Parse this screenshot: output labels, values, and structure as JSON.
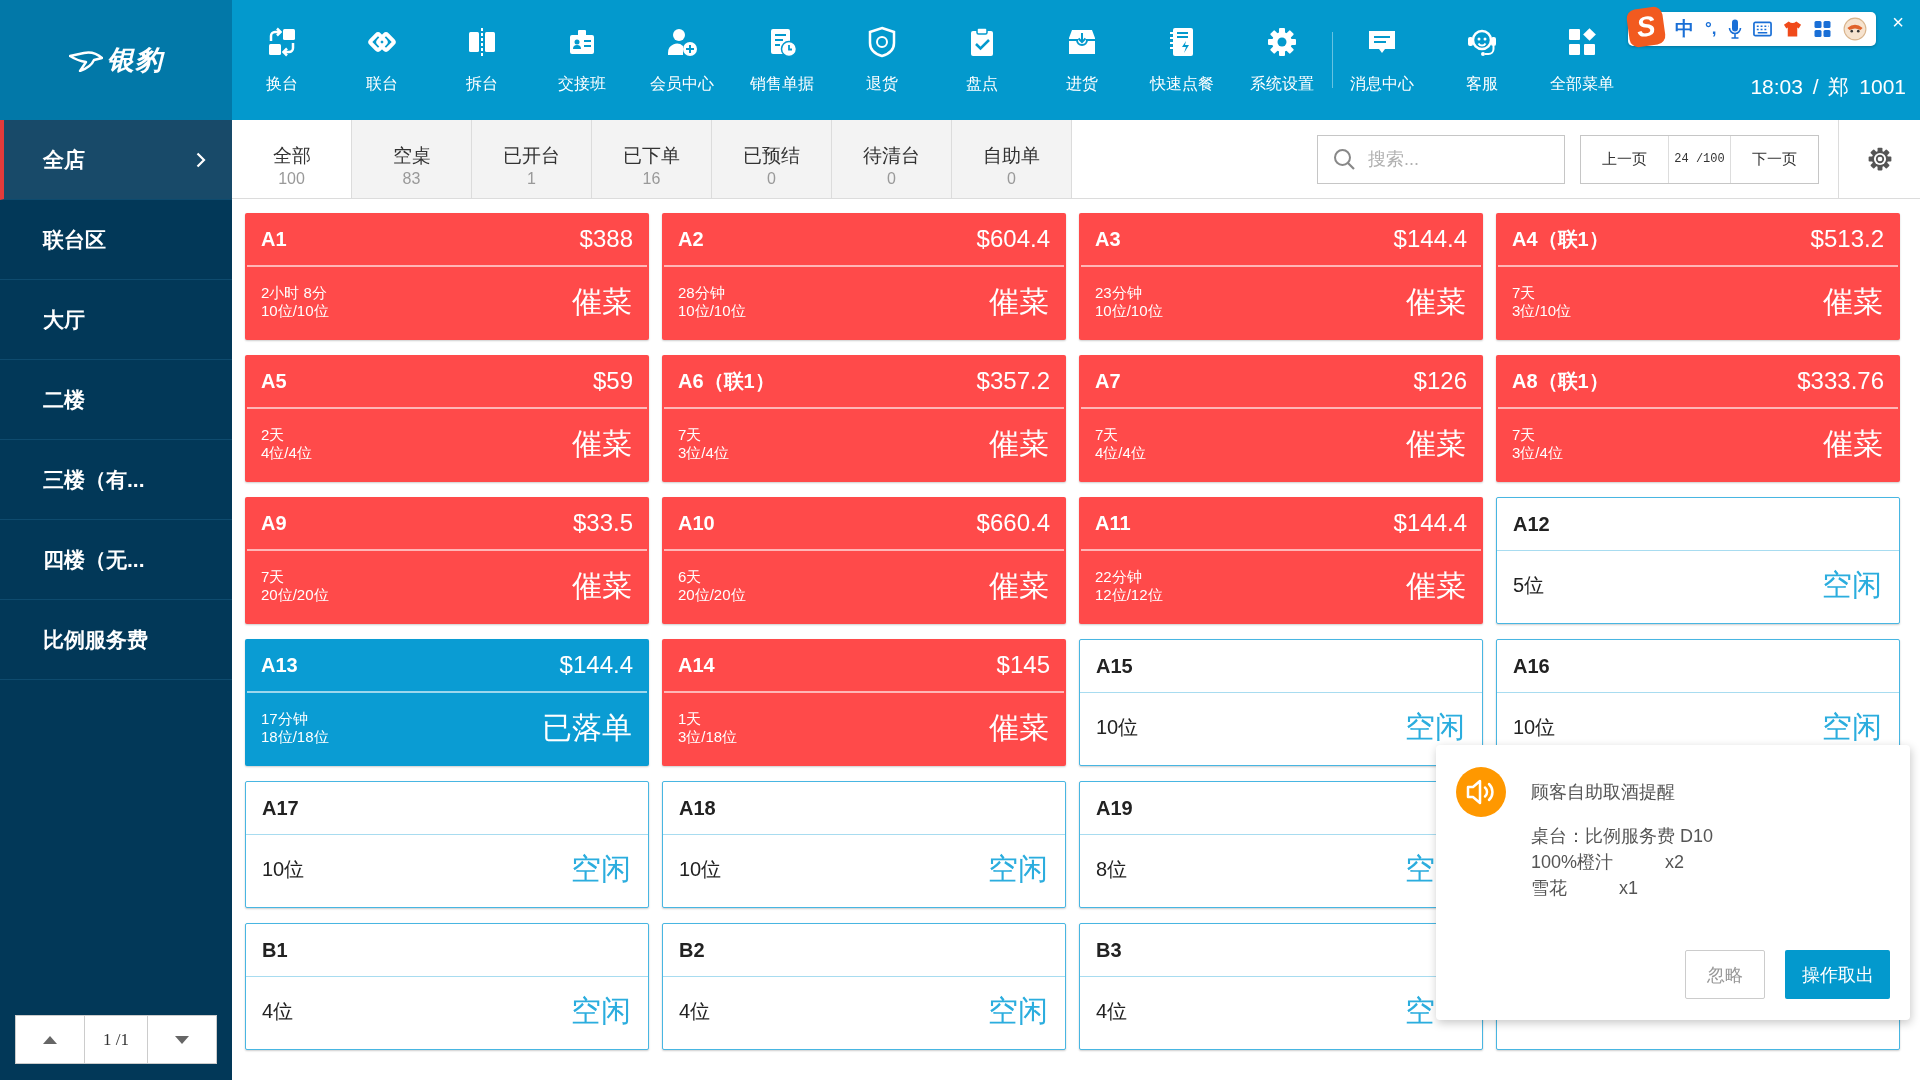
{
  "app": {
    "logo": "银豹"
  },
  "toolbar": {
    "main": [
      "换台",
      "联台",
      "拆台",
      "交接班",
      "会员中心",
      "销售单据",
      "退货",
      "盘点",
      "进货",
      "快速点餐",
      "系统设置"
    ],
    "extra": [
      "消息中心",
      "客服",
      "全部菜单"
    ]
  },
  "status_text": "18:03 / 郑 1001",
  "ime_bar": {
    "logo": "S",
    "mode": "中",
    "punct": "°,"
  },
  "window": {
    "close": "×"
  },
  "areas": [
    {
      "label": "全店",
      "selected": true
    },
    {
      "label": "联台区",
      "selected": false
    },
    {
      "label": "大厅",
      "selected": false
    },
    {
      "label": "二楼",
      "selected": false
    },
    {
      "label": "三楼（有...",
      "selected": false
    },
    {
      "label": "四楼（无...",
      "selected": false
    },
    {
      "label": "比例服务费",
      "selected": false
    }
  ],
  "area_pager": {
    "page": "1 /1"
  },
  "tabs": [
    {
      "label": "全部",
      "count": "100",
      "selected": true
    },
    {
      "label": "空桌",
      "count": "83",
      "selected": false
    },
    {
      "label": "已开台",
      "count": "1",
      "selected": false
    },
    {
      "label": "已下单",
      "count": "16",
      "selected": false
    },
    {
      "label": "已预结",
      "count": "0",
      "selected": false
    },
    {
      "label": "待清台",
      "count": "0",
      "selected": false
    },
    {
      "label": "自助单",
      "count": "0",
      "selected": false
    }
  ],
  "search": {
    "placeholder": "搜索..."
  },
  "page_nav": {
    "prev": "上一页",
    "page": "24 /100",
    "next": "下一页"
  },
  "table_rows": [
    [
      {
        "kind": "urge",
        "name": "A1",
        "amount": "$388",
        "duration": "2小时 8分",
        "seats": "10位/10位",
        "status": "催菜"
      },
      {
        "kind": "urge",
        "name": "A2",
        "amount": "$604.4",
        "duration": "28分钟",
        "seats": "10位/10位",
        "status": "催菜"
      },
      {
        "kind": "urge",
        "name": "A3",
        "amount": "$144.4",
        "duration": "23分钟",
        "seats": "10位/10位",
        "status": "催菜"
      },
      {
        "kind": "urge",
        "name": "A4（联1）",
        "amount": "$513.2",
        "duration": "7天",
        "seats": "3位/10位",
        "status": "催菜"
      }
    ],
    [
      {
        "kind": "urge",
        "name": "A5",
        "amount": "$59",
        "duration": "2天",
        "seats": "4位/4位",
        "status": "催菜"
      },
      {
        "kind": "urge",
        "name": "A6（联1）",
        "amount": "$357.2",
        "duration": "7天",
        "seats": "3位/4位",
        "status": "催菜"
      },
      {
        "kind": "urge",
        "name": "A7",
        "amount": "$126",
        "duration": "7天",
        "seats": "4位/4位",
        "status": "催菜"
      },
      {
        "kind": "urge",
        "name": "A8（联1）",
        "amount": "$333.76",
        "duration": "7天",
        "seats": "3位/4位",
        "status": "催菜"
      }
    ],
    [
      {
        "kind": "urge",
        "name": "A9",
        "amount": "$33.5",
        "duration": "7天",
        "seats": "20位/20位",
        "status": "催菜"
      },
      {
        "kind": "urge",
        "name": "A10",
        "amount": "$660.4",
        "duration": "6天",
        "seats": "20位/20位",
        "status": "催菜"
      },
      {
        "kind": "urge",
        "name": "A11",
        "amount": "$144.4",
        "duration": "22分钟",
        "seats": "12位/12位",
        "status": "催菜"
      },
      {
        "kind": "idle",
        "name": "A12",
        "seats": "5位",
        "status": "空闲"
      }
    ],
    [
      {
        "kind": "ordered",
        "name": "A13",
        "amount": "$144.4",
        "duration": "17分钟",
        "seats": "18位/18位",
        "status": "已落单"
      },
      {
        "kind": "urge",
        "name": "A14",
        "amount": "$145",
        "duration": "1天",
        "seats": "3位/18位",
        "status": "催菜"
      },
      {
        "kind": "idle",
        "name": "A15",
        "seats": "10位",
        "status": "空闲"
      },
      {
        "kind": "idle",
        "name": "A16",
        "seats": "10位",
        "status": "空闲"
      }
    ],
    [
      {
        "kind": "idle",
        "name": "A17",
        "seats": "10位",
        "status": "空闲"
      },
      {
        "kind": "idle",
        "name": "A18",
        "seats": "10位",
        "status": "空闲"
      },
      {
        "kind": "idle",
        "name": "A19",
        "seats": "8位",
        "status": "空"
      }
    ],
    [
      {
        "kind": "idle",
        "name": "B1",
        "seats": "4位",
        "status": "空闲"
      },
      {
        "kind": "idle",
        "name": "B2",
        "seats": "4位",
        "status": "空闲"
      },
      {
        "kind": "idle",
        "name": "B3",
        "seats": "4位",
        "status": "空"
      },
      {
        "kind": "idle"
      }
    ]
  ],
  "popup": {
    "title": "顾客自助取酒提醒",
    "table": "桌台：比例服务费 D10",
    "items": [
      {
        "name": "100%橙汁",
        "qty": "x2"
      },
      {
        "name": "雪花",
        "qty": "x1"
      }
    ],
    "buttons": [
      {
        "label": "忽略",
        "kind": "secondary"
      },
      {
        "label": "操作取出",
        "kind": "primary"
      }
    ]
  }
}
